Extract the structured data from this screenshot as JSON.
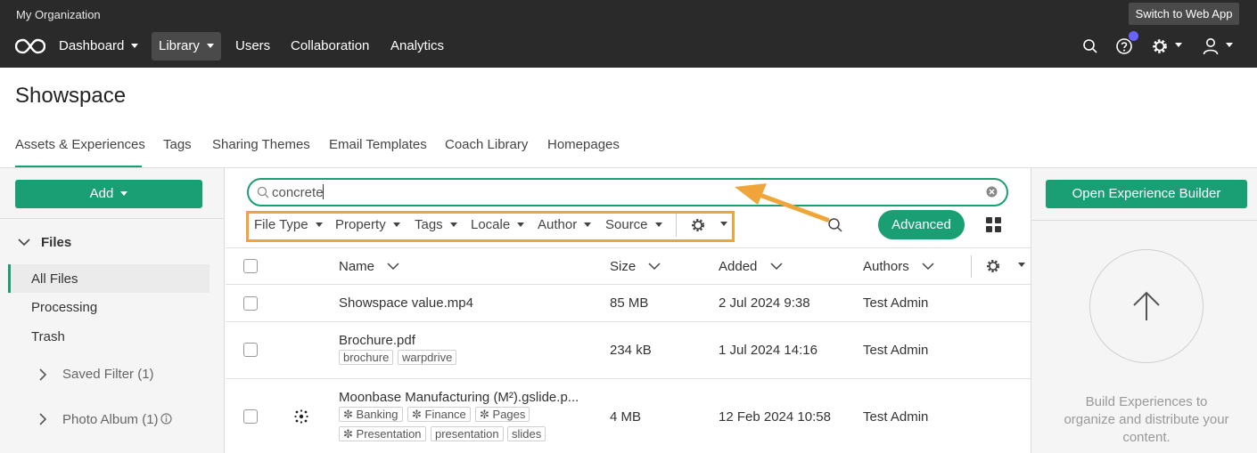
{
  "org_name": "My Organization",
  "switch_label": "Switch to Web App",
  "nav": {
    "dashboard": "Dashboard",
    "library": "Library",
    "users": "Users",
    "collaboration": "Collaboration",
    "analytics": "Analytics"
  },
  "page_title": "Showspace",
  "tabs": [
    "Assets & Experiences",
    "Tags",
    "Sharing Themes",
    "Email Templates",
    "Coach Library",
    "Homepages"
  ],
  "sidebar": {
    "add_label": "Add",
    "files_label": "Files",
    "links": [
      "All Files",
      "Processing",
      "Trash"
    ],
    "groups": [
      "Saved Filter (1)",
      "Photo Album (1)"
    ]
  },
  "search": {
    "value": "concrete"
  },
  "filters": [
    "File Type",
    "Property",
    "Tags",
    "Locale",
    "Author",
    "Source"
  ],
  "advanced_label": "Advanced",
  "table": {
    "columns": [
      "Name",
      "Size",
      "Added",
      "Authors"
    ],
    "rows": [
      {
        "name": "Showspace value.mp4",
        "size": "85 MB",
        "added": "2 Jul 2024 9:38",
        "author": "Test Admin",
        "tags": []
      },
      {
        "name": "Brochure.pdf",
        "size": "234 kB",
        "added": "1 Jul 2024 14:16",
        "author": "Test Admin",
        "tags": [
          "brochure",
          "warpdrive"
        ]
      },
      {
        "name": "Moonbase Manufacturing (M²).gslide.p...",
        "size": "4 MB",
        "added": "12 Feb 2024 10:58",
        "author": "Test Admin",
        "tags": [
          "Banking",
          "Finance",
          "Pages",
          "Presentation",
          "presentation",
          "slides"
        ]
      }
    ]
  },
  "right_panel": {
    "button_label": "Open Experience Builder",
    "build_text": "Build Experiences to organize and distribute your content."
  },
  "colors": {
    "accent": "#1a9e74",
    "highlight": "#f0a53a",
    "topbar": "#2a2a2a",
    "notification": "#6b63ff"
  },
  "icons": [
    "logo-icon",
    "search-icon",
    "help-icon",
    "gear-icon",
    "user-icon",
    "grid-view-icon",
    "upload-arrow-icon",
    "clear-icon",
    "chevron-down-icon",
    "chevron-right-icon",
    "network-icon",
    "info-icon"
  ]
}
